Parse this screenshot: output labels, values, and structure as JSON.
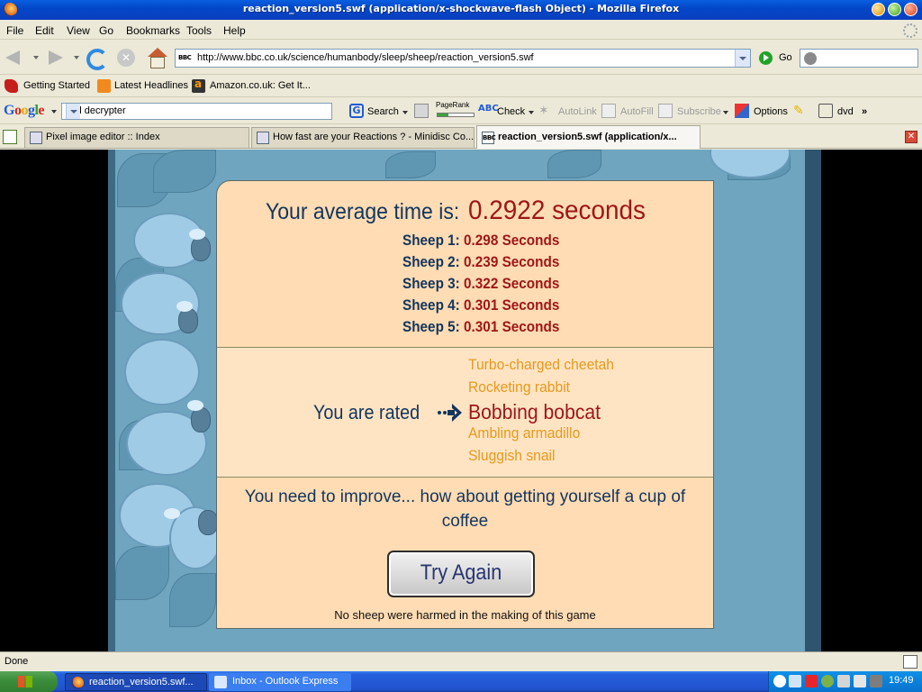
{
  "window": {
    "title": "reaction_version5.swf (application/x-shockwave-flash Object) - Mozilla Firefox"
  },
  "menu": [
    "File",
    "Edit",
    "View",
    "Go",
    "Bookmarks",
    "Tools",
    "Help"
  ],
  "nav": {
    "url": "http://www.bbc.co.uk/science/humanbody/sleep/sheep/reaction_version5.swf",
    "go_label": "Go",
    "favicon_text": "BBC"
  },
  "bookmarks": [
    "Getting Started",
    "Latest Headlines",
    "Amazon.co.uk: Get It..."
  ],
  "google_toolbar": {
    "logo": [
      "G",
      "o",
      "o",
      "g",
      "l",
      "e"
    ],
    "query": "dvd decrypter",
    "search_label": "Search",
    "pagerank_label": "PageRank",
    "pagerank_fraction": 0.3,
    "check_label": "Check",
    "check_icon_text": "ABC",
    "autolink_label": "AutoLink",
    "autofill_label": "AutoFill",
    "subscribe_label": "Subscribe",
    "options_label": "Options",
    "dvd_label": "dvd",
    "more_label": "»"
  },
  "tabs": [
    {
      "label": "Pixel image editor :: Index",
      "active": false
    },
    {
      "label": "How fast are your Reactions ? - Minidisc Co...",
      "active": false
    },
    {
      "label": "reaction_version5.swf (application/x...",
      "active": true
    }
  ],
  "results": {
    "average_label": "Your average time is:",
    "average_value": "0.2922 seconds",
    "sheep": [
      {
        "label": "Sheep 1:",
        "value": "0.298 Seconds"
      },
      {
        "label": "Sheep 2:",
        "value": "0.239 Seconds"
      },
      {
        "label": "Sheep 3:",
        "value": "0.322 Seconds"
      },
      {
        "label": "Sheep 4:",
        "value": "0.301 Seconds"
      },
      {
        "label": "Sheep 5:",
        "value": "0.301 Seconds"
      }
    ],
    "rated_label": "You are rated",
    "ratings": [
      "Turbo-charged cheetah",
      "Rocketing rabbit",
      "Bobbing bobcat",
      "Ambling armadillo",
      "Sluggish snail"
    ],
    "current_rating_index": 2,
    "improve_text": "You need to improve... how about getting yourself a cup of coffee",
    "try_again_label": "Try Again",
    "footnote": "No sheep were harmed in the making of this game"
  },
  "status": {
    "text": "Done"
  },
  "taskbar": {
    "tasks": [
      "reaction_version5.swf...",
      "Inbox - Outlook Express"
    ],
    "clock": "19:49",
    "tray_icons": [
      "help-icon",
      "network-icon",
      "zonealarm-icon",
      "messenger-icon",
      "volume-icon",
      "display-icon",
      "antivirus-icon"
    ]
  },
  "colors": {
    "panel_bg": "#ffdcb4",
    "navy_text": "#13355c",
    "red_value": "#9c1717",
    "orange_rating": "#e49a1e"
  }
}
